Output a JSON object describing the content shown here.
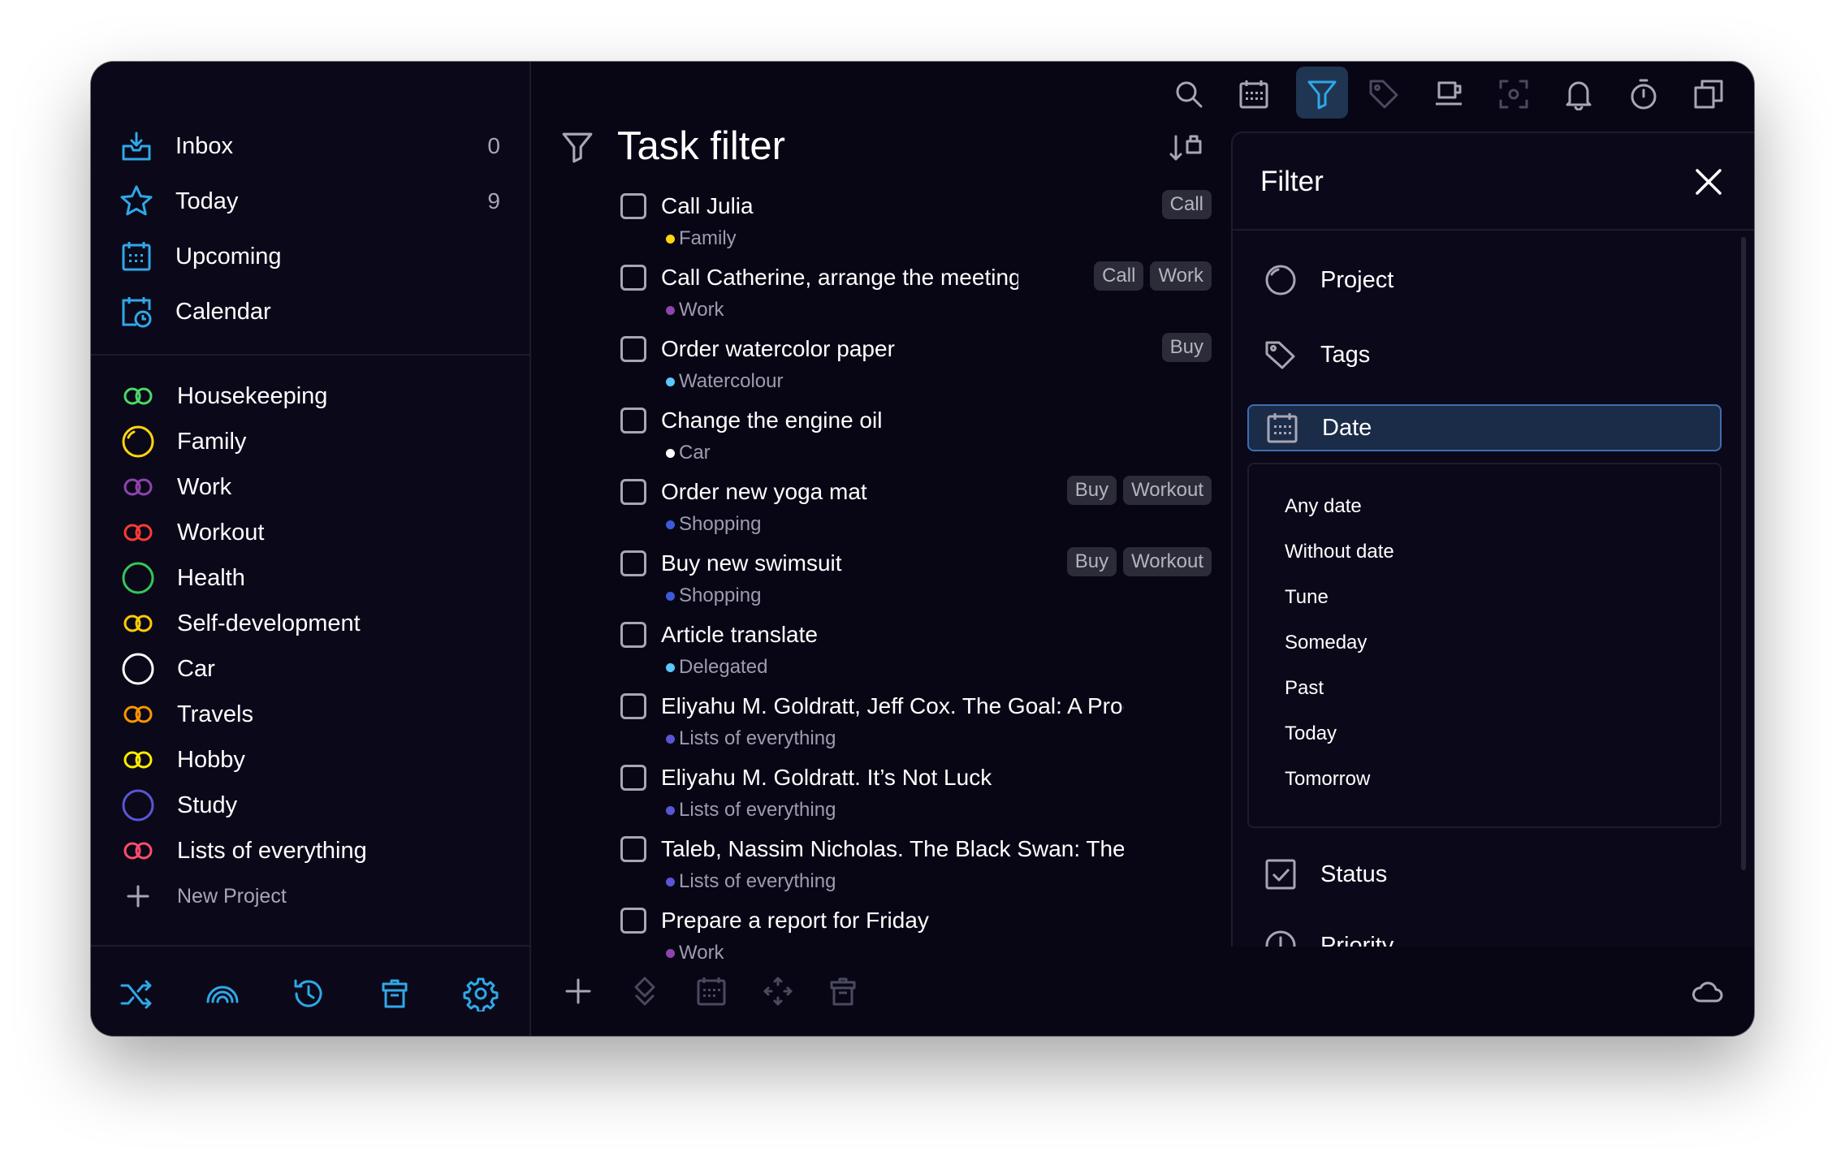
{
  "sidebar": {
    "nav": [
      {
        "label": "Inbox",
        "count": "0",
        "icon": "inbox-icon"
      },
      {
        "label": "Today",
        "count": "9",
        "icon": "star-icon"
      },
      {
        "label": "Upcoming",
        "count": "",
        "icon": "calendar-grid-icon"
      },
      {
        "label": "Calendar",
        "count": "",
        "icon": "calendar-clock-icon"
      }
    ],
    "projects": [
      {
        "label": "Housekeeping",
        "color": "#4cd964",
        "shape": "double"
      },
      {
        "label": "Family",
        "color": "#ffd60a",
        "shape": "single"
      },
      {
        "label": "Work",
        "color": "#8e44ad",
        "shape": "double"
      },
      {
        "label": "Workout",
        "color": "#ff3b30",
        "shape": "double"
      },
      {
        "label": "Health",
        "color": "#34c759",
        "shape": "single"
      },
      {
        "label": "Self-development",
        "color": "#ffcc00",
        "shape": "double"
      },
      {
        "label": "Car",
        "color": "#ffffff",
        "shape": "single"
      },
      {
        "label": "Travels",
        "color": "#ff9500",
        "shape": "double"
      },
      {
        "label": "Hobby",
        "color": "#ffea00",
        "shape": "double"
      },
      {
        "label": "Study",
        "color": "#5856d6",
        "shape": "single"
      },
      {
        "label": "Lists of everything",
        "color": "#ff4d6d",
        "shape": "double"
      }
    ],
    "new_project_label": "New Project",
    "bottom_icons": [
      "shuffle-icon",
      "rainbow-icon",
      "history-icon",
      "trash-icon",
      "settings-icon"
    ]
  },
  "toolbar": {
    "icons": [
      "search-icon",
      "calendar-icon",
      "filter-icon",
      "tag-icon",
      "coffee-icon",
      "focus-icon",
      "bell-icon",
      "timer-icon",
      "windows-icon"
    ],
    "active": "filter-icon"
  },
  "main": {
    "title": "Task filter",
    "tasks": [
      {
        "title": "Call Julia",
        "project": "Family",
        "dot": "#ffd60a",
        "tags": [
          "Call"
        ]
      },
      {
        "title": "Call Catherine, arrange the meeting",
        "project": "Work",
        "dot": "#8e44ad",
        "tags": [
          "Call",
          "Work"
        ]
      },
      {
        "title": "Order watercolor paper",
        "project": "Watercolour",
        "dot": "#5ac8fa",
        "tags": [
          "Buy"
        ]
      },
      {
        "title": "Change the engine oil",
        "project": "Car",
        "dot": "#ffffff",
        "tags": []
      },
      {
        "title": "Order new yoga mat",
        "project": "Shopping",
        "dot": "#3b5bdb",
        "tags": [
          "Buy",
          "Workout"
        ]
      },
      {
        "title": "Buy new swimsuit",
        "project": "Shopping",
        "dot": "#3b5bdb",
        "tags": [
          "Buy",
          "Workout"
        ]
      },
      {
        "title": "Article translate",
        "project": "Delegated",
        "dot": "#5ac8fa",
        "tags": []
      },
      {
        "title": "Eliyahu M. Goldratt, Jeff Cox. The Goal: A Process of Ongoing Improvement",
        "project": "Lists of everything",
        "dot": "#5856d6",
        "tags": []
      },
      {
        "title": "Eliyahu M. Goldratt. It’s Not Luck",
        "project": "Lists of everything",
        "dot": "#5856d6",
        "tags": []
      },
      {
        "title": "Taleb, Nassim Nicholas. The Black Swan: The Impact",
        "project": "Lists of everything",
        "dot": "#5856d6",
        "tags": []
      },
      {
        "title": "Prepare a report for Friday",
        "project": "Work",
        "dot": "#8e44ad",
        "tags": []
      }
    ],
    "bottom_icons": [
      "add-icon",
      "priority-icon",
      "date-icon",
      "move-icon",
      "trash-icon"
    ]
  },
  "filter": {
    "title": "Filter",
    "rows": [
      {
        "label": "Project",
        "icon": "project-circle-icon"
      },
      {
        "label": "Tags",
        "icon": "tag-icon"
      },
      {
        "label": "Date",
        "icon": "calendar-icon",
        "active": true
      },
      {
        "label": "Status",
        "icon": "checkbox-icon"
      },
      {
        "label": "Priority",
        "icon": "priority-icon"
      }
    ],
    "date_options": [
      "Any date",
      "Without date",
      "Tune",
      "Someday",
      "Past",
      "Today",
      "Tomorrow"
    ]
  },
  "colors": {
    "accent": "#2fa8e8",
    "background": "#080614",
    "active_row": "#1b2c49"
  }
}
